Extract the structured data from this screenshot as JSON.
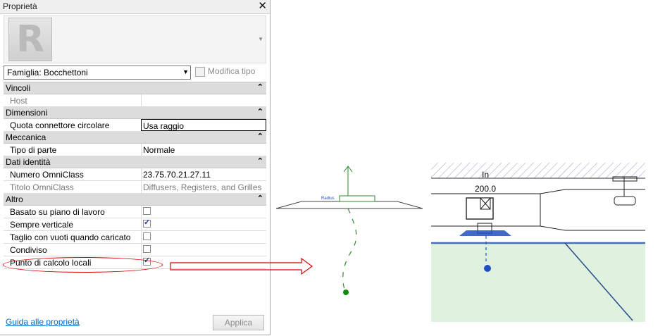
{
  "panel": {
    "title": "Proprietà",
    "close_glyph": "✕",
    "logo_letter": "R",
    "family_selector": "Famiglia: Bocchettoni",
    "edit_type": "Modifica tipo",
    "groups": [
      {
        "title": "Vincoli",
        "rows": [
          {
            "label": "Host",
            "value": ""
          }
        ]
      },
      {
        "title": "Dimensioni",
        "rows": [
          {
            "label": "Quota connettore circolare",
            "value": "Usa raggio"
          }
        ]
      },
      {
        "title": "Meccanica",
        "rows": [
          {
            "label": "Tipo di parte",
            "value": "Normale"
          }
        ]
      },
      {
        "title": "Dati identità",
        "rows": [
          {
            "label": "Numero OmniClass",
            "value": "23.75.70.21.27.11"
          },
          {
            "label": "Titolo OmniClass",
            "value": "Diffusers, Registers, and Grilles"
          }
        ]
      },
      {
        "title": "Altro",
        "rows": [
          {
            "label": "Basato su piano di lavoro",
            "checked": false
          },
          {
            "label": "Sempre verticale",
            "checked": true
          },
          {
            "label": "Taglio con vuoti quando caricato",
            "checked": false
          },
          {
            "label": "Condiviso",
            "checked": false
          },
          {
            "label": "Punto di calcolo locali",
            "checked": true
          }
        ]
      }
    ],
    "collapse_glyph": "⌃",
    "help_link": "Guida alle proprietà",
    "apply_button": "Applica"
  },
  "view1": {
    "small_label": "Radius"
  },
  "view2": {
    "label_in": "In",
    "label_dim": "200.0"
  },
  "colors": {
    "header_bg": "#dcdcdc",
    "annotation_red": "#d40000",
    "model_green": "#2e8b2e",
    "connector_blue": "#1f4fbf",
    "floor_green": "#dff2df"
  }
}
